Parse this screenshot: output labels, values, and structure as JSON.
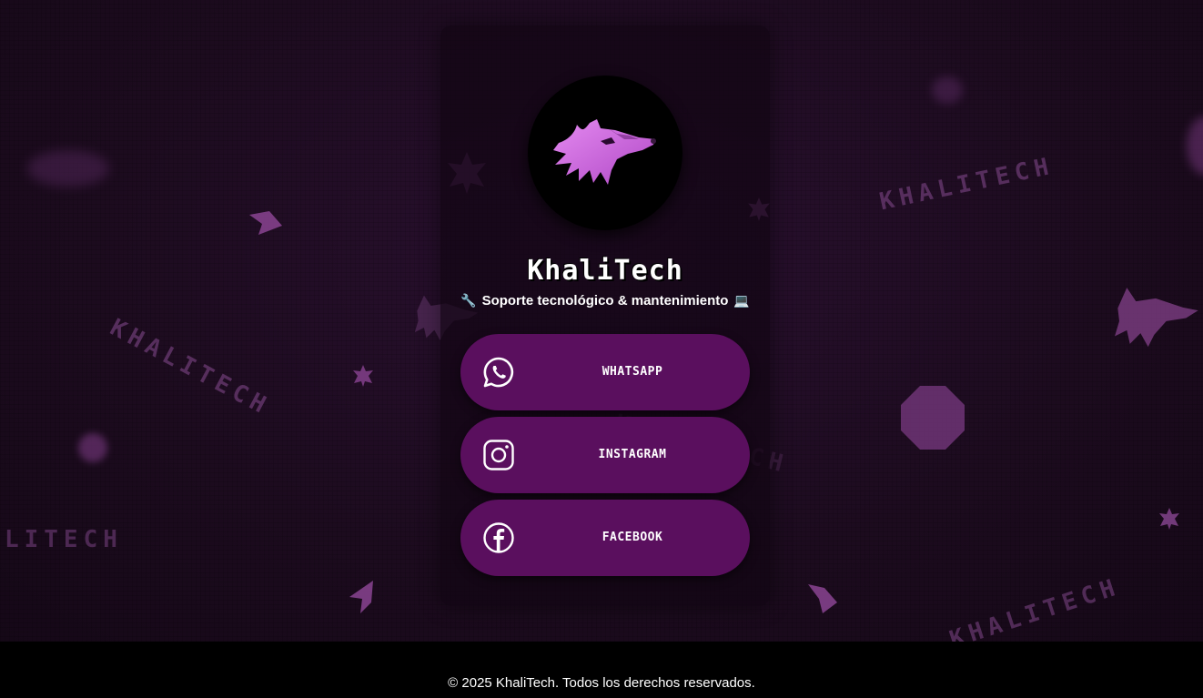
{
  "background": {
    "watermark_text": "KHALITECH"
  },
  "profile": {
    "avatar_icon": "wolf-logo",
    "title": "KhaliTech",
    "subtitle_prefix_icon": "🔧",
    "subtitle": "Soporte tecnológico & mantenimiento",
    "subtitle_suffix_icon": "💻"
  },
  "links": [
    {
      "label": "WHATSAPP",
      "icon": "whatsapp-icon"
    },
    {
      "label": "INSTAGRAM",
      "icon": "instagram-icon"
    },
    {
      "label": "FACEBOOK",
      "icon": "facebook-icon"
    }
  ],
  "footer": {
    "text": "© 2025 KhaliTech. Todos los derechos reservados."
  },
  "colors": {
    "background": "#1c0b1e",
    "button": "#5a0f5e",
    "accent": "#c560d8",
    "footer": "#000000"
  }
}
